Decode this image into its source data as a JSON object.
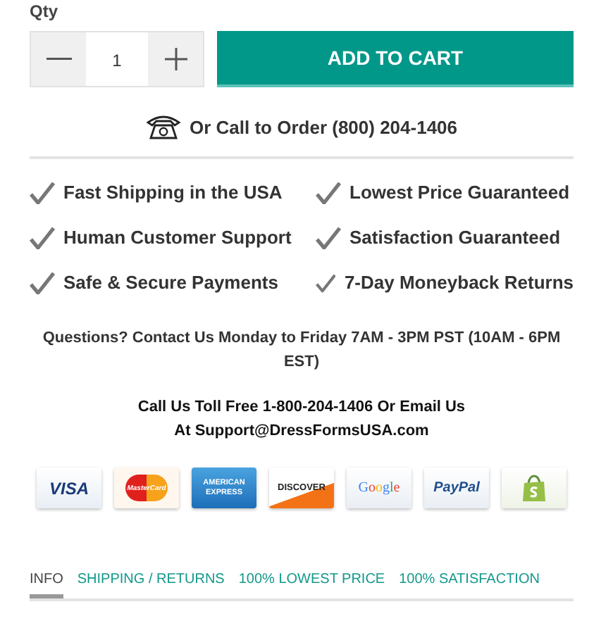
{
  "quantity": {
    "label": "Qty",
    "value": "1"
  },
  "add_to_cart": "ADD TO CART",
  "phone_order": "Or Call to Order (800) 204-1406",
  "features": [
    "Fast Shipping in the USA",
    "Lowest Price Guaranteed",
    "Human Customer Support",
    "Satisfaction Guaranteed",
    "Safe & Secure Payments",
    "7-Day Moneyback Returns"
  ],
  "hours": "Questions? Contact Us Monday to Friday 7AM - 3PM PST (10AM - 6PM EST)",
  "contact": "Call Us Toll Free 1-800-204-1406 Or Email Us At Support@DressFormsUSA.com",
  "payments": [
    {
      "kind": "visa",
      "text": "VISA"
    },
    {
      "kind": "mastercard",
      "text": "MasterCard"
    },
    {
      "kind": "amex",
      "text": "AMERICAN EXPRESS"
    },
    {
      "kind": "discover",
      "text": "DISCOVER"
    },
    {
      "kind": "google",
      "text": "Google"
    },
    {
      "kind": "paypal",
      "text": "PayPal"
    },
    {
      "kind": "shopify"
    }
  ],
  "tabs": [
    {
      "label": "INFO",
      "selected": true
    },
    {
      "label": "SHIPPING / RETURNS",
      "selected": false
    },
    {
      "label": "100% LOWEST PRICE",
      "selected": false
    },
    {
      "label": "100% SATISFACTION",
      "selected": false
    }
  ]
}
